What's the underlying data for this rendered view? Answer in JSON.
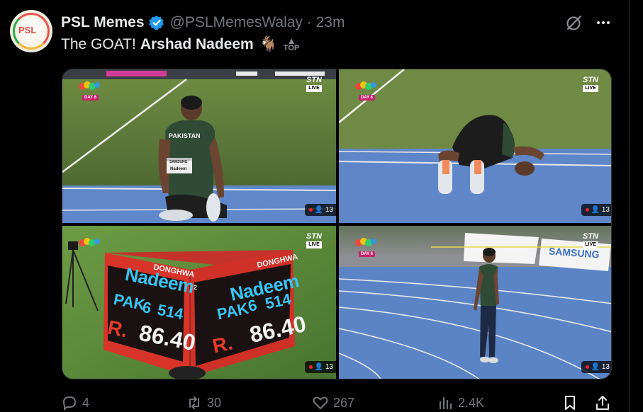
{
  "tweet": {
    "display_name": "PSL Memes",
    "handle": "@PSLMemesWalay",
    "separator": "·",
    "time": "23m",
    "text_prefix": "The GOAT!",
    "text_bold": "Arshad Nadeem",
    "goat_emoji": "🐐",
    "top_emoji_label": "TOP",
    "avatar_text": "PSL"
  },
  "media": {
    "broadcaster": "STN",
    "broadcast_badge": "LIVE",
    "day_tag": "DAY 6",
    "viewer_count": "13",
    "photo1_shirt": "PAKISTAN",
    "photo1_bib_brand": "SAMSUNG",
    "photo1_bib_name": "Nadeem",
    "scoreboard": {
      "brand": "DONGHWA",
      "name": "Nadeem",
      "country": "PAK",
      "attempt": "6",
      "bib": "514",
      "r_label": "R.",
      "score": "86.40",
      "side_number": "2"
    },
    "photo4_sponsor": "SAMSUNG"
  },
  "actions": {
    "replies": "4",
    "reposts": "30",
    "likes": "267",
    "views": "2.4K"
  },
  "colors": {
    "background": "#000000",
    "text": "#e7e9ea",
    "muted": "#71767b",
    "verified": "#1d9bf0",
    "scoreboard_blue": "#38c4f2",
    "scoreboard_red": "#e63a2b"
  }
}
